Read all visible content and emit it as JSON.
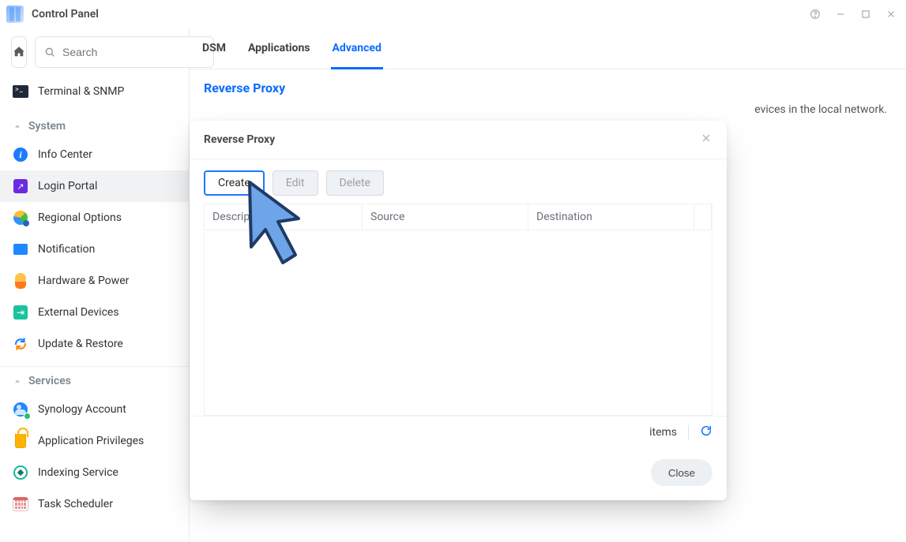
{
  "window": {
    "title": "Control Panel"
  },
  "sidebar": {
    "search_placeholder": "Search",
    "top_item_label": "Terminal & SNMP",
    "sections": {
      "system": {
        "label": "System"
      },
      "services": {
        "label": "Services"
      }
    },
    "items": {
      "info_center": "Info Center",
      "login_portal": "Login Portal",
      "regional": "Regional Options",
      "notification": "Notification",
      "hardware": "Hardware & Power",
      "external": "External Devices",
      "update": "Update & Restore",
      "synacct": "Synology Account",
      "apppriv": "Application Privileges",
      "indexing": "Indexing Service",
      "tasksched": "Task Scheduler"
    }
  },
  "tabs": {
    "dsm": "DSM",
    "apps": "Applications",
    "advanced": "Advanced"
  },
  "page": {
    "section_title": "Reverse Proxy",
    "desc_tail": "evices in the local network."
  },
  "modal": {
    "title": "Reverse Proxy",
    "buttons": {
      "create": "Create",
      "edit": "Edit",
      "delete": "Delete",
      "close": "Close"
    },
    "columns": {
      "description": "Description",
      "source": "Source",
      "destination": "Destination"
    },
    "status_items_label": "items"
  }
}
